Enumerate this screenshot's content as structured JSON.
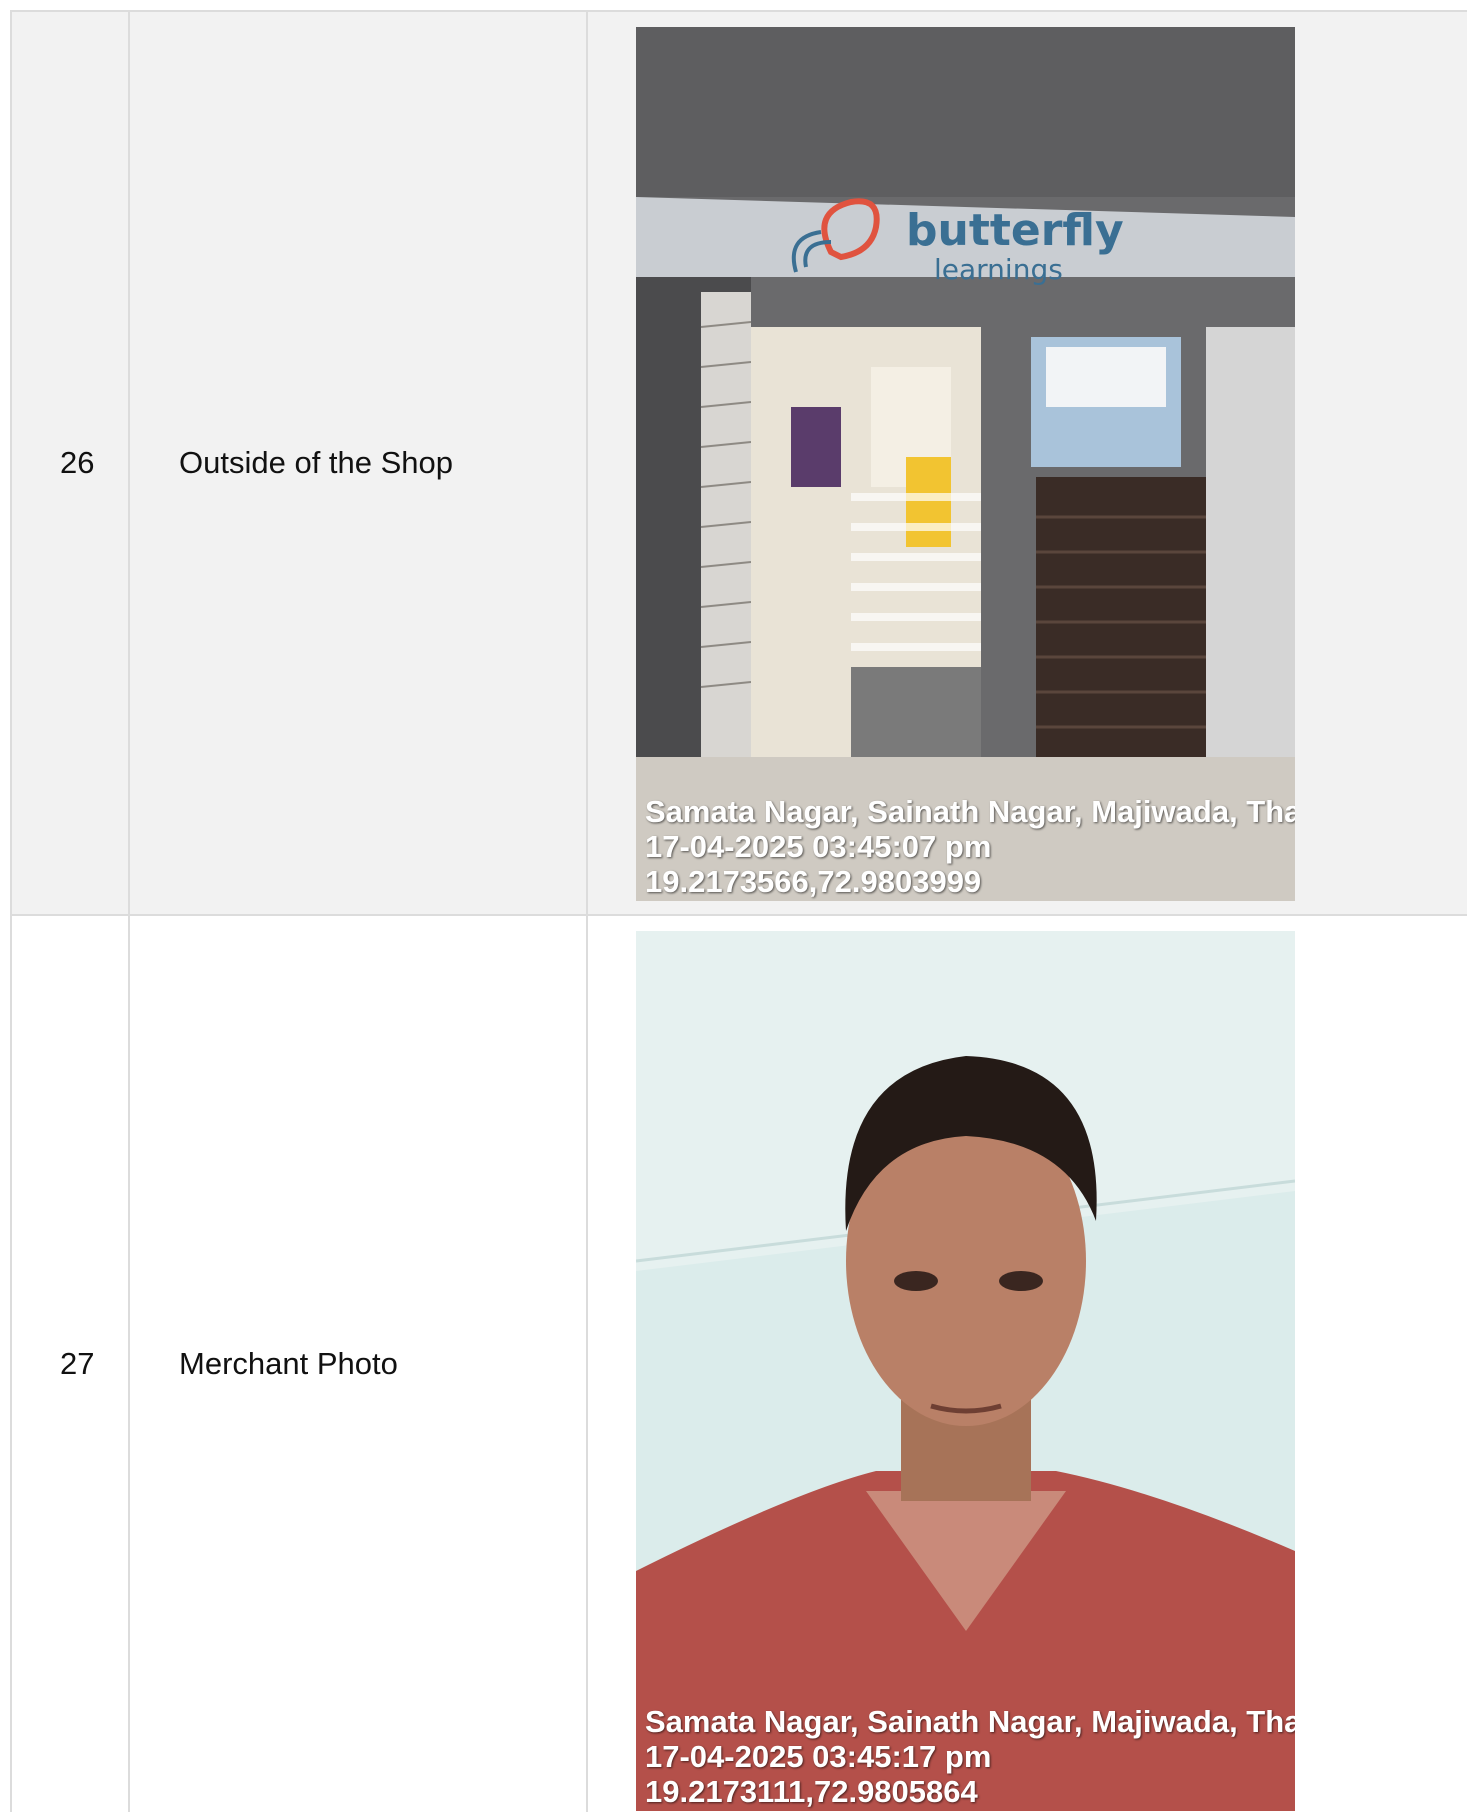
{
  "rows": [
    {
      "number": "26",
      "label": "Outside of the Shop",
      "photo": {
        "subject": "shop entrance with sign",
        "sign_text_1": "butterfly",
        "sign_text_2": "learnings",
        "stamp_address": "Samata Nagar, Sainath Nagar, Majiwada, Tha",
        "stamp_datetime": "17-04-2025 03:45:07 pm",
        "stamp_coords": "19.2173566,72.9803999"
      }
    },
    {
      "number": "27",
      "label": "Merchant Photo",
      "photo": {
        "subject": "merchant selfie",
        "stamp_address": "Samata Nagar, Sainath Nagar, Majiwada, Tha",
        "stamp_datetime": "17-04-2025 03:45:17 pm",
        "stamp_coords": "19.2173111,72.9805864"
      }
    }
  ],
  "colors": {
    "border": "#dcdcdc",
    "row_alt": "#f2f2f2",
    "sign_blue": "#3a6f93",
    "sign_red": "#e0533f",
    "shirt": "#b4504a"
  }
}
